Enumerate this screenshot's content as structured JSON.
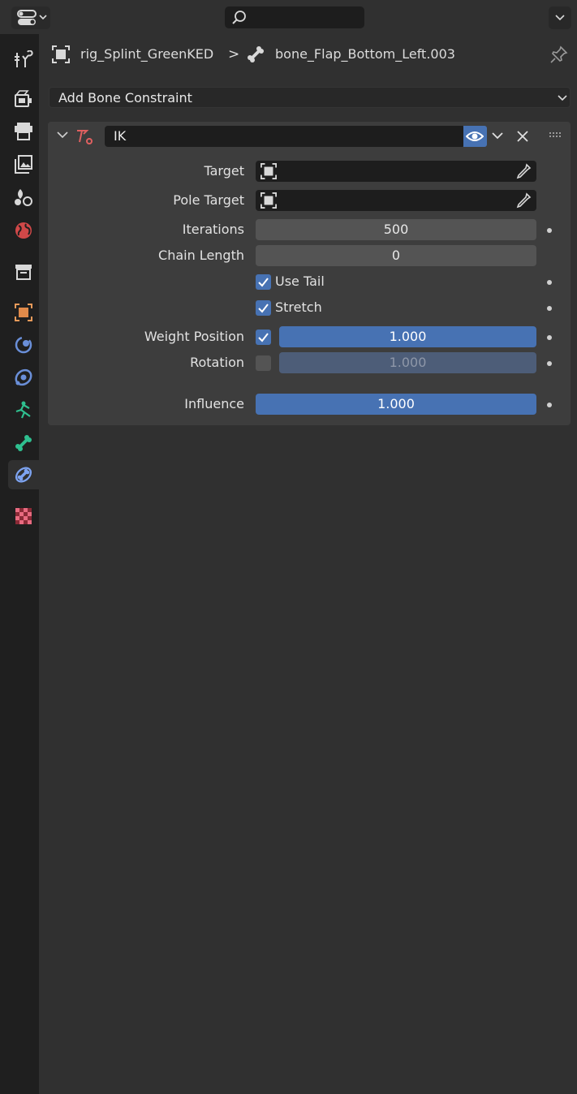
{
  "header": {
    "object_name": "rig_Splint_GreenKED",
    "separator": ">",
    "bone_name": "bone_Flap_Bottom_Left.003"
  },
  "sidebar": {
    "tabs": [
      {
        "name": "tool-tab",
        "icon": "tool-icon"
      },
      {
        "name": "render-tab",
        "icon": "render-icon"
      },
      {
        "name": "output-tab",
        "icon": "output-icon"
      },
      {
        "name": "view-layer-tab",
        "icon": "view-layer-icon"
      },
      {
        "name": "scene-tab",
        "icon": "scene-icon"
      },
      {
        "name": "world-tab",
        "icon": "world-icon"
      },
      {
        "name": "collection-tab",
        "icon": "collection-icon"
      },
      {
        "name": "object-tab",
        "icon": "object-icon"
      },
      {
        "name": "modifiers-tab",
        "icon": "modifier-icon"
      },
      {
        "name": "object-constraints-tab",
        "icon": "object-constraint-icon"
      },
      {
        "name": "object-data-tab",
        "icon": "armature-icon"
      },
      {
        "name": "bone-tab",
        "icon": "bone-icon"
      },
      {
        "name": "bone-constraints-tab",
        "icon": "bone-constraint-icon",
        "active": true
      },
      {
        "name": "texture-tab",
        "icon": "texture-icon"
      }
    ]
  },
  "add_constraint": {
    "label": "Add Bone Constraint"
  },
  "constraint": {
    "name": "IK",
    "fields": {
      "target_label": "Target",
      "pole_target_label": "Pole Target",
      "iterations_label": "Iterations",
      "iterations_value": "500",
      "chain_length_label": "Chain Length",
      "chain_length_value": "0",
      "use_tail_label": "Use Tail",
      "use_tail_checked": true,
      "stretch_label": "Stretch",
      "stretch_checked": true,
      "weight_position_label": "Weight Position",
      "weight_position_checked": true,
      "weight_position_value": "1.000",
      "rotation_label": "Rotation",
      "rotation_checked": false,
      "rotation_value": "1.000",
      "influence_label": "Influence",
      "influence_value": "1.000"
    }
  },
  "colors": {
    "accent": "#4772b3",
    "background": "#303030",
    "sidebar": "#1f1f1f",
    "panel": "#3d3d3d"
  }
}
